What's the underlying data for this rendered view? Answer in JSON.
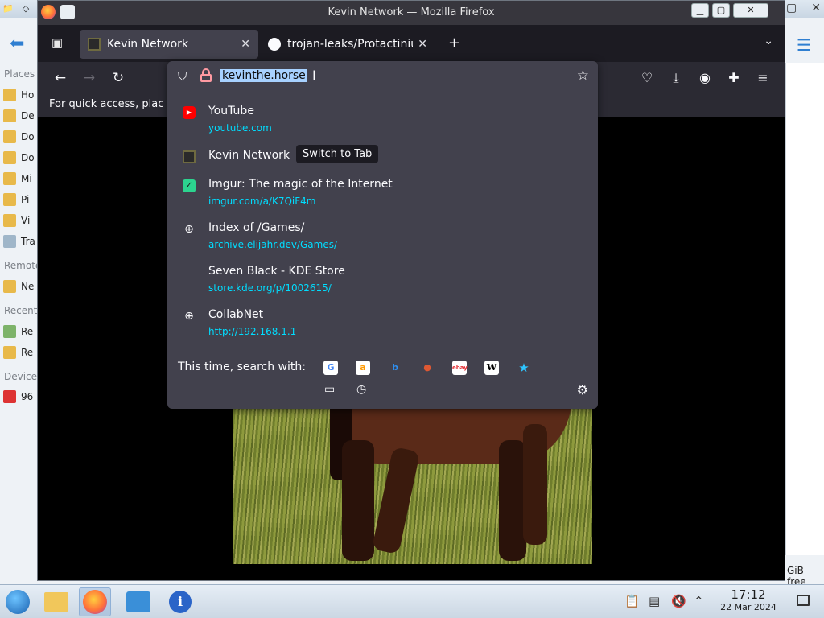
{
  "background": {
    "sidebar_sections": [
      "Places",
      "Remote",
      "Recent",
      "Devices"
    ],
    "sidebar_items": [
      "Ho",
      "De",
      "Do",
      "Do",
      "Mi",
      "Pi",
      "Vi",
      "Tra",
      "Ne",
      "Re",
      "Re",
      "96"
    ],
    "free_space_text": "GiB free"
  },
  "window": {
    "title": "Kevin Network — Mozilla Firefox",
    "buttons": {
      "minimize": "▁",
      "maximize": "▢",
      "close": "✕"
    }
  },
  "tabs": [
    {
      "label": "Kevin Network",
      "active": true
    },
    {
      "label": "trojan-leaks/Protactinium",
      "active": false
    }
  ],
  "tab_close_glyph": "✕",
  "new_tab_glyph": "+",
  "list_tabs_glyph": "⌄",
  "bookmarks_bar": {
    "text": "For quick access, plac"
  },
  "urlbar": {
    "value": "kevinthe.horse",
    "cursor_glyph": "I",
    "star_glyph": "☆"
  },
  "suggestions": [
    {
      "title": "YouTube",
      "url": "youtube.com",
      "icon": "youtube-icon"
    },
    {
      "title": "Kevin Network",
      "url": "",
      "icon": "kevin-network-icon",
      "action": "Switch to Tab"
    },
    {
      "title": "Imgur: The magic of the Internet",
      "url": "imgur.com/a/K7QiF4m",
      "icon": "imgur-icon"
    },
    {
      "title": "Index of /Games/",
      "url": "archive.elijahr.dev/Games/",
      "icon": "globe-icon"
    },
    {
      "title": "Seven Black - KDE Store",
      "url": "store.kde.org/p/1002615/",
      "icon": "blank-icon"
    },
    {
      "title": "CollabNet",
      "url": "http://192.168.1.1",
      "icon": "globe-icon"
    }
  ],
  "search_row": {
    "label": "This time, search with:",
    "engines": [
      {
        "name": "Google",
        "glyph": "G",
        "bg": "#ffffff",
        "fg": "#4285f4"
      },
      {
        "name": "Amazon",
        "glyph": "a",
        "bg": "#ffffff",
        "fg": "#ff9900"
      },
      {
        "name": "Bing",
        "glyph": "b",
        "bg": "#42414d",
        "fg": "#2f8ff0"
      },
      {
        "name": "DuckDuckGo",
        "glyph": "●",
        "bg": "#42414d",
        "fg": "#de5833"
      },
      {
        "name": "eBay",
        "glyph": "ebay",
        "bg": "#ffffff",
        "fg": "#e53238"
      },
      {
        "name": "Wikipedia",
        "glyph": "W",
        "bg": "#ffffff",
        "fg": "#000000"
      },
      {
        "name": "Bookmarks",
        "glyph": "★",
        "bg": "#42414d",
        "fg": "#2ec5ff"
      }
    ]
  },
  "taskbar": {
    "clock_time": "17:12",
    "clock_date": "22 Mar 2024"
  },
  "colors": {
    "toolbar": "#2b2a33",
    "panel": "#42414d",
    "url_link": "#00ddff",
    "selection": "#a7d1ff"
  }
}
